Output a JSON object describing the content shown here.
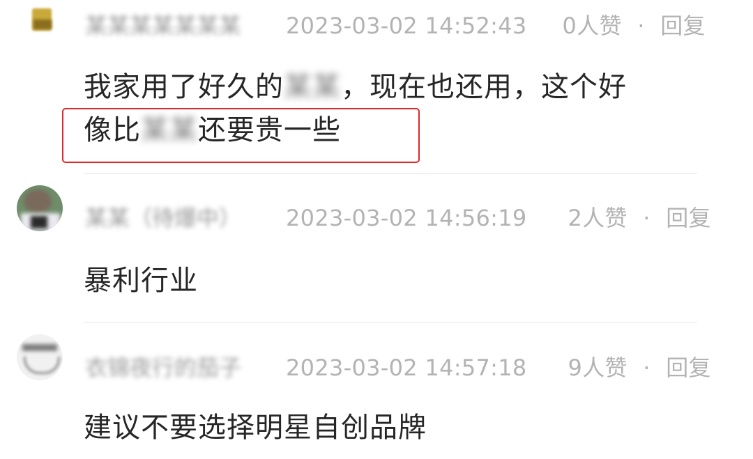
{
  "comments": [
    {
      "nickname": "某某某某某某某",
      "timestamp": "2023-03-02 14:52:43",
      "likes": "0人赞",
      "sep": "·",
      "reply": "回复",
      "text_part1": "我家用了好久的",
      "text_hidden1": "某某",
      "text_part2": "，现在也还用，这个好",
      "text_part3": "像比",
      "text_hidden2": "某某",
      "text_part4": "还要贵一些"
    },
    {
      "nickname": "某某（待爆中）",
      "timestamp": "2023-03-02 14:56:19",
      "likes": "2人赞",
      "sep": "·",
      "reply": "回复",
      "text": "暴利行业"
    },
    {
      "nickname": "衣锦夜行的茄子",
      "timestamp": "2023-03-02 14:57:18",
      "likes": "9人赞",
      "sep": "·",
      "reply": "回复",
      "text": "建议不要选择明星自创品牌"
    }
  ],
  "highlight_color": "#e0262b"
}
